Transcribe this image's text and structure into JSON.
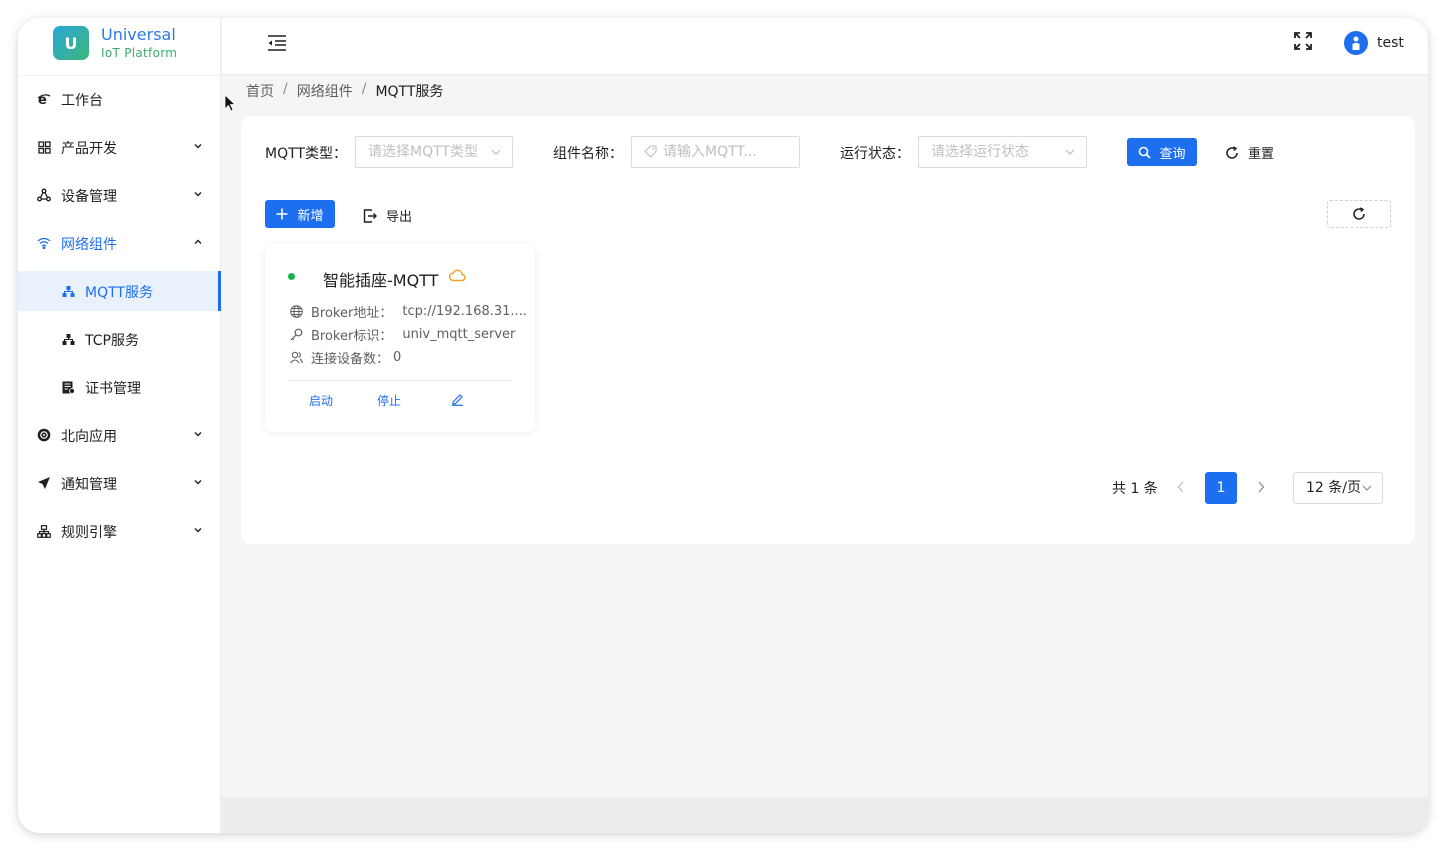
{
  "app": {
    "logo_letter": "U",
    "logo_title": "Universal",
    "logo_subtitle": "IoT Platform"
  },
  "sidebar": {
    "items": [
      {
        "label": "工作台",
        "icon": "ie-icon"
      },
      {
        "label": "产品开发",
        "icon": "grid-icon"
      },
      {
        "label": "设备管理",
        "icon": "network-icon"
      },
      {
        "label": "网络组件",
        "icon": "wifi-icon",
        "open": true
      },
      {
        "label": "北向应用",
        "icon": "compass-icon"
      },
      {
        "label": "通知管理",
        "icon": "send-icon"
      },
      {
        "label": "规则引擎",
        "icon": "hierarchy-icon"
      }
    ],
    "sub_items": [
      {
        "label": "MQTT服务",
        "icon": "nodes-icon",
        "active": true
      },
      {
        "label": "TCP服务",
        "icon": "nodes-icon"
      },
      {
        "label": "证书管理",
        "icon": "certificate-icon"
      }
    ]
  },
  "header": {
    "username": "test"
  },
  "breadcrumb": {
    "items": [
      "首页",
      "网络组件",
      "MQTT服务"
    ]
  },
  "filters": {
    "type_label": "MQTT类型：",
    "type_placeholder": "请选择MQTT类型",
    "name_label": "组件名称：",
    "name_placeholder": "请输入MQTT...",
    "status_label": "运行状态：",
    "status_placeholder": "请选择运行状态",
    "search_label": "查询",
    "reset_label": "重置"
  },
  "toolbar": {
    "add_label": "新增",
    "export_label": "导出"
  },
  "card": {
    "title": "智能插座-MQTT",
    "status_color": "#17b350",
    "broker_address_label": "Broker地址：",
    "broker_address_value": "tcp://192.168.31....",
    "broker_id_label": "Broker标识：",
    "broker_id_value": "univ_mqtt_server",
    "connected_label": "连接设备数：",
    "connected_value": "0",
    "start_label": "启动",
    "stop_label": "停止"
  },
  "pagination": {
    "total": "共 1 条",
    "current_page": "1",
    "page_size": "12 条/页"
  },
  "colors": {
    "accent": "#1e6ff0",
    "online": "#17b350",
    "cloud": "#f0a020"
  }
}
